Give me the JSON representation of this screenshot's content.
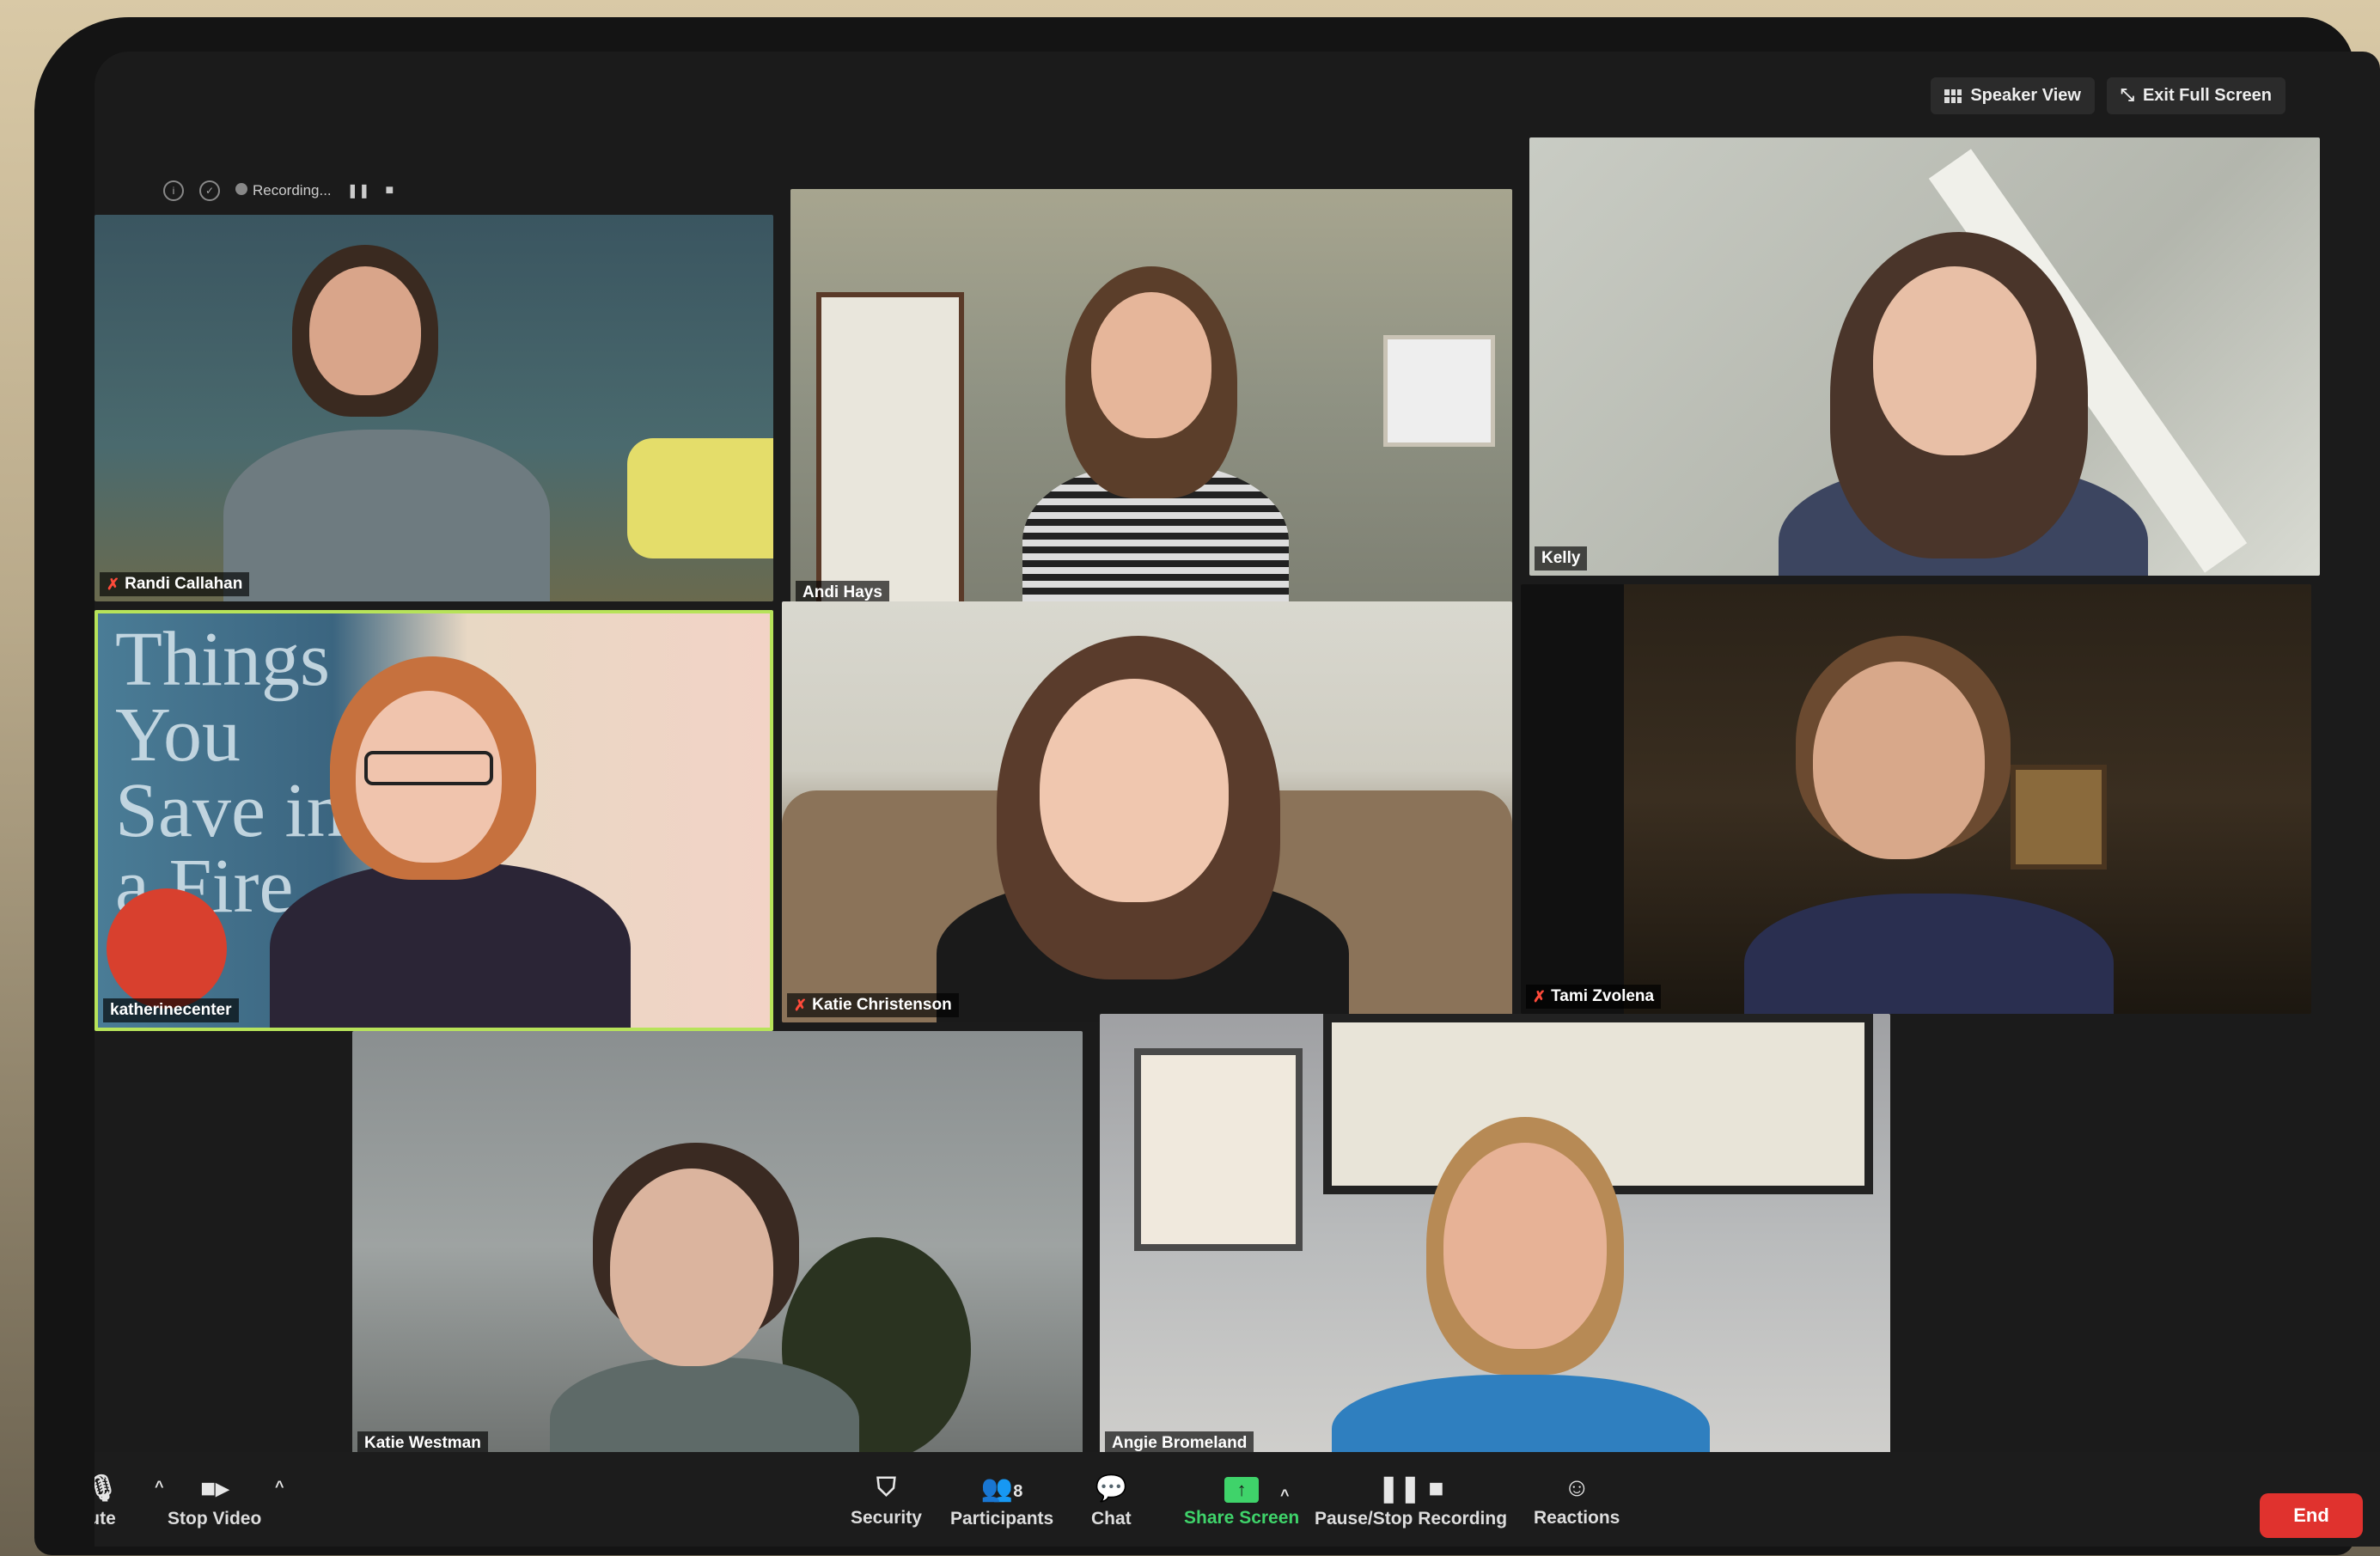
{
  "header": {
    "recording_label": "Recording...",
    "speaker_view_label": "Speaker View",
    "exit_fullscreen_label": "Exit Full Screen"
  },
  "participants": [
    {
      "name": "Randi Callahan",
      "muted": true
    },
    {
      "name": "Andi Hays",
      "muted": false
    },
    {
      "name": "Kelly",
      "muted": false
    },
    {
      "name": "katherinecenter",
      "muted": false,
      "active_speaker": true
    },
    {
      "name": "Katie Christenson",
      "muted": true
    },
    {
      "name": "Tami Zvolena",
      "muted": true
    },
    {
      "name": "Katie Westman",
      "muted": false
    },
    {
      "name": "Angie Bromeland",
      "muted": false
    }
  ],
  "book_cover_text": "Things You Save in a Fire",
  "toolbar": {
    "mute_label": "ute",
    "stop_video_label": "Stop Video",
    "security_label": "Security",
    "participants_label": "Participants",
    "participants_count": "8",
    "chat_label": "Chat",
    "share_screen_label": "Share Screen",
    "pause_stop_recording_label": "Pause/Stop Recording",
    "reactions_label": "Reactions",
    "end_label": "End"
  },
  "icons": {
    "mute": "mic-icon",
    "video": "video-camera-icon",
    "security": "shield-icon",
    "participants": "people-icon",
    "chat": "chat-bubble-icon",
    "share": "share-screen-icon",
    "recording": "pause-stop-icon",
    "reactions": "smiley-icon"
  },
  "colors": {
    "active_speaker_border": "#b7e35a",
    "share_green": "#3fd36a",
    "end_red": "#e0322e",
    "muted_red": "#ff4a3a"
  }
}
